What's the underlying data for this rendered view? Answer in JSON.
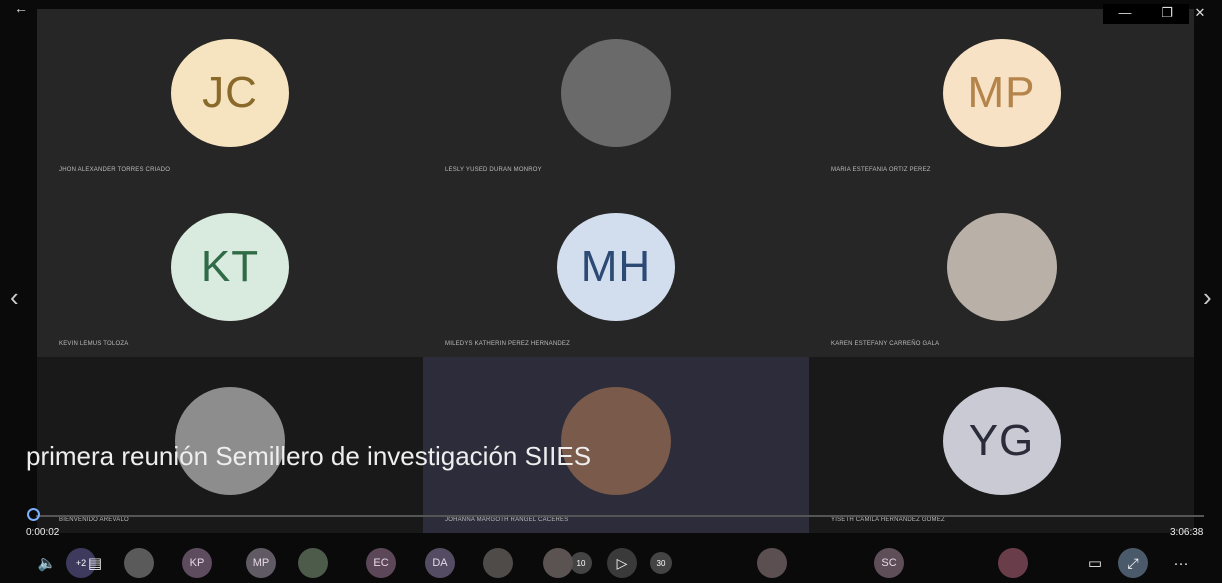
{
  "window": {
    "back_icon": "←",
    "minimize_icon": "—",
    "restore_icon": "❐",
    "close_icon": "✕"
  },
  "participants": [
    {
      "initials": "JC",
      "name": "JHON ALEXANDER TORRES CRIADO",
      "avatar_color": "#f6e4c1",
      "text_color": "#8a6a2a",
      "tile": "alt"
    },
    {
      "initials": "",
      "name": "LESLY YUSED DURAN MONROY",
      "avatar_color": "#6a6a6a",
      "text_color": "#000",
      "tile": "alt",
      "photo": true
    },
    {
      "initials": "MP",
      "name": "MARIA ESTEFANIA ORTIZ PEREZ",
      "avatar_color": "#f7e2c5",
      "text_color": "#b5844b",
      "tile": "alt"
    },
    {
      "initials": "KT",
      "name": "KEVIN LEMUS TOLOZA",
      "avatar_color": "#d9eadf",
      "text_color": "#2e6b46",
      "tile": "alt"
    },
    {
      "initials": "MH",
      "name": "MILEDYS KATHERIN PEREZ HERNANDEZ",
      "avatar_color": "#d2deee",
      "text_color": "#2d4a74",
      "tile": "alt"
    },
    {
      "initials": "",
      "name": "KAREN ESTEFANY CARREÑO GALA",
      "avatar_color": "#b9b0a8",
      "text_color": "#000",
      "tile": "alt",
      "photo": true
    },
    {
      "initials": "",
      "name": "Bienvenido Arevalo",
      "avatar_color": "#8d8d8d",
      "text_color": "#000",
      "tile": "dim",
      "photo": true
    },
    {
      "initials": "",
      "name": "JOHANNA MARGOTH RANGEL CACERES",
      "avatar_color": "#7a5a4a",
      "text_color": "#000",
      "tile": "highlight",
      "photo": true
    },
    {
      "initials": "YG",
      "name": "YISETH CAMILA HERNANDEZ GOMEZ",
      "avatar_color": "#c9cad3",
      "text_color": "#2a2c3a",
      "tile": "dim"
    }
  ],
  "navigation": {
    "prev_icon": "‹",
    "next_icon": "›"
  },
  "caption": "primera reunión Semillero de investigación SIIES",
  "player": {
    "elapsed": "0:00:02",
    "total": "3:06:38",
    "progress_fraction": 0.0002,
    "volume_icon": "🔈",
    "captions_icon": "▤",
    "overflow_badge": "+2",
    "skip_back": "10",
    "skip_forward": "30",
    "play_icon": "▷",
    "miniview_icon": "▭",
    "fullscreen_icon": "⤢",
    "more_icon": "···"
  },
  "bottom_avatars": [
    {
      "label": "",
      "color": "#5a5a5a"
    },
    {
      "label": "KP",
      "color": "#5d4b5e"
    },
    {
      "label": "MP",
      "color": "#5f5a63"
    },
    {
      "label": "",
      "color": "#4d5b4a"
    },
    {
      "label": "EC",
      "color": "#5b4758"
    },
    {
      "label": "DA",
      "color": "#544c63"
    },
    {
      "label": "",
      "color": "#4f4b48"
    },
    {
      "label": "",
      "color": "#5a5352"
    },
    {
      "label": "",
      "color": "#5c4f52"
    },
    {
      "label": "SC",
      "color": "#5e4e58"
    },
    {
      "label": "",
      "color": "#6a3d4a"
    }
  ]
}
